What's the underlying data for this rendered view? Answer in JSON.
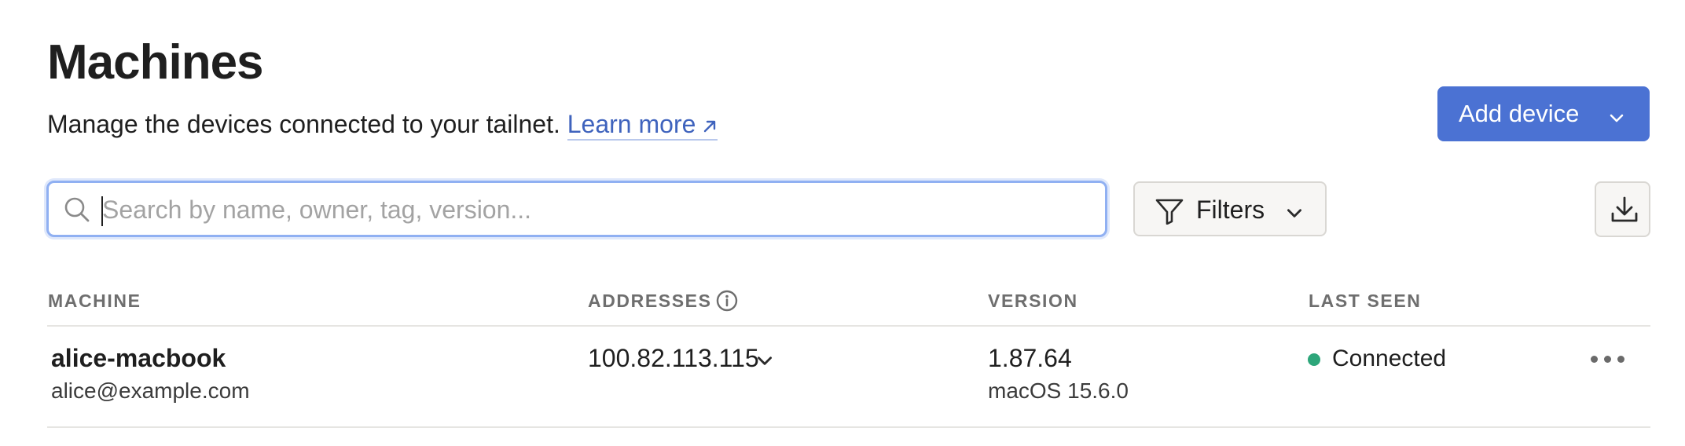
{
  "header": {
    "title": "Machines",
    "subtitle": "Manage the devices connected to your tailnet.",
    "learn_more": "Learn more",
    "add_device": "Add device"
  },
  "toolbar": {
    "search_placeholder": "Search by name, owner, tag, version...",
    "search_value": "",
    "filters_label": "Filters"
  },
  "table": {
    "columns": [
      "MACHINE",
      "ADDRESSES",
      "VERSION",
      "LAST SEEN"
    ],
    "rows": [
      {
        "machine": "alice-macbook",
        "owner": "alice@example.com",
        "address": "100.82.113.115",
        "version": "1.87.64",
        "os": "macOS 15.6.0",
        "last_seen": "Connected",
        "status_color": "#2da67a"
      }
    ]
  },
  "colors": {
    "accent": "#4b72d3",
    "link": "#3f63bd",
    "status_connected": "#2da67a"
  },
  "icons": [
    "arrow-up-right-icon",
    "chevron-down-icon",
    "search-icon",
    "filter-icon",
    "download-icon",
    "info-icon",
    "more-icon"
  ]
}
